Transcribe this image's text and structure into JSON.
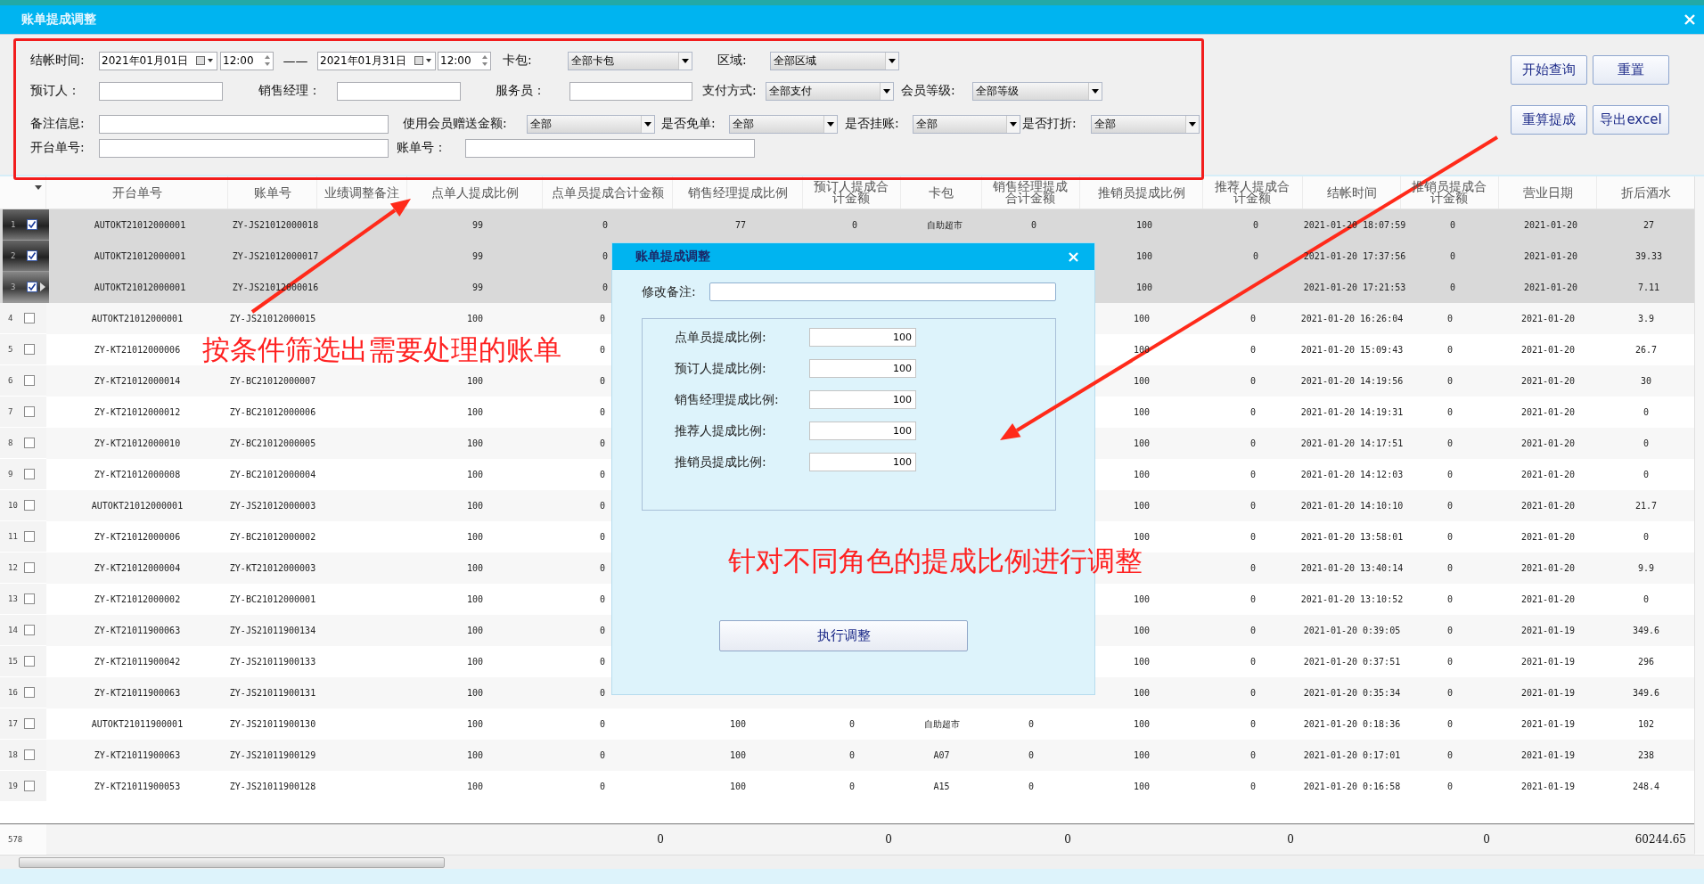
{
  "window": {
    "title": "账单提成调整"
  },
  "filters": {
    "checkout_time": {
      "label": "结帐时间:",
      "start_date": "2021年01月01日",
      "start_time": "12:00",
      "separator": "——",
      "end_date": "2021年01月31日",
      "end_time": "12:00"
    },
    "card_package": {
      "label": "卡包:",
      "value": "全部卡包"
    },
    "area": {
      "label": "区域:",
      "value": "全部区域"
    },
    "booker": {
      "label": "预订人："
    },
    "sales_manager": {
      "label": "销售经理："
    },
    "waiter": {
      "label": "服务员："
    },
    "payment_method": {
      "label": "支付方式:",
      "value": "全部支付"
    },
    "member_level": {
      "label": "会员等级:",
      "value": "全部等级"
    },
    "remark": {
      "label": "备注信息:"
    },
    "member_gift_amount": {
      "label": "使用会员赠送金额:",
      "value": "全部"
    },
    "free_bill": {
      "label": "是否免单:",
      "value": "全部"
    },
    "on_account": {
      "label": "是否挂账:",
      "value": "全部"
    },
    "discounted": {
      "label": "是否打折:",
      "value": "全部"
    },
    "open_order_no": {
      "label": "开台单号:"
    },
    "bill_no": {
      "label": "账单号："
    }
  },
  "buttons": [
    "开始查询",
    "重置",
    "重算提成",
    "导出excel"
  ],
  "table": {
    "columns": [
      {
        "label": "开台单号"
      },
      {
        "label": "账单号"
      },
      {
        "label": "业绩调整备注"
      },
      {
        "label": "点单人提成比例"
      },
      {
        "label": "点单员提成合计金额",
        "total": "0"
      },
      {
        "label": "销售经理提成比例"
      },
      {
        "label": "预订人提成合计金额",
        "total": "0"
      },
      {
        "label": "卡包"
      },
      {
        "label": "销售经理提成合计金额",
        "total": "0"
      },
      {
        "label": "推销员提成比例"
      },
      {
        "label": "推荐人提成合计金额",
        "total": "0"
      },
      {
        "label": "结帐时间"
      },
      {
        "label": "推销员提成合计金额",
        "total": "0"
      },
      {
        "label": "营业日期"
      },
      {
        "label": "折后酒水",
        "total": "60244.65"
      }
    ],
    "rows": [
      {
        "number": "1",
        "checked": true,
        "selected": true,
        "current": false,
        "cells": [
          "AUTOKT21012000001",
          "ZY-JS21012000018",
          null,
          "99",
          "0",
          "77",
          "0",
          "自助超市",
          "0",
          "100",
          "0",
          "2021-01-20 18:07:59",
          "0",
          "2021-01-20",
          "27"
        ]
      },
      {
        "number": "2",
        "checked": true,
        "selected": true,
        "current": false,
        "cells": [
          "AUTOKT21012000001",
          "ZY-JS21012000017",
          null,
          "99",
          "0",
          null,
          null,
          null,
          null,
          "100",
          "0",
          "2021-01-20 17:37:56",
          "0",
          "2021-01-20",
          "39.33"
        ]
      },
      {
        "number": "3",
        "checked": true,
        "selected": true,
        "current": true,
        "cells": [
          "AUTOKT21012000001",
          "ZY-JS21012000016",
          null,
          "99",
          "0",
          null,
          null,
          null,
          null,
          "100",
          null,
          "2021-01-20 17:21:53",
          "0",
          "2021-01-20",
          "7.11"
        ]
      },
      {
        "number": "4",
        "checked": false,
        "selected": false,
        "current": false,
        "cells": [
          "AUTOKT21012000001",
          "ZY-JS21012000015",
          null,
          "100",
          "0",
          null,
          null,
          null,
          null,
          "100",
          "0",
          "2021-01-20 16:26:04",
          "0",
          "2021-01-20",
          "3.9"
        ]
      },
      {
        "number": "5",
        "checked": false,
        "selected": false,
        "current": false,
        "cells": [
          "ZY-KT21012000006",
          null,
          null,
          null,
          "0",
          null,
          null,
          null,
          null,
          "100",
          "0",
          "2021-01-20 15:09:43",
          "0",
          "2021-01-20",
          "26.7"
        ]
      },
      {
        "number": "6",
        "checked": false,
        "selected": false,
        "current": false,
        "cells": [
          "ZY-KT21012000014",
          "ZY-BC21012000007",
          null,
          "100",
          "0",
          null,
          null,
          null,
          null,
          "100",
          "0",
          "2021-01-20 14:19:56",
          "0",
          "2021-01-20",
          "30"
        ]
      },
      {
        "number": "7",
        "checked": false,
        "selected": false,
        "current": false,
        "cells": [
          "ZY-KT21012000012",
          "ZY-BC21012000006",
          null,
          "100",
          "0",
          null,
          null,
          null,
          null,
          "100",
          "0",
          "2021-01-20 14:19:31",
          "0",
          "2021-01-20",
          "0"
        ]
      },
      {
        "number": "8",
        "checked": false,
        "selected": false,
        "current": false,
        "cells": [
          "ZY-KT21012000010",
          "ZY-BC21012000005",
          null,
          "100",
          "0",
          null,
          null,
          null,
          null,
          "100",
          "0",
          "2021-01-20 14:17:51",
          "0",
          "2021-01-20",
          "0"
        ]
      },
      {
        "number": "9",
        "checked": false,
        "selected": false,
        "current": false,
        "cells": [
          "ZY-KT21012000008",
          "ZY-BC21012000004",
          null,
          "100",
          "0",
          null,
          null,
          null,
          null,
          "100",
          "0",
          "2021-01-20 14:12:03",
          "0",
          "2021-01-20",
          "0"
        ]
      },
      {
        "number": "10",
        "checked": false,
        "selected": false,
        "current": false,
        "cells": [
          "AUTOKT21012000001",
          "ZY-JS21012000003",
          null,
          "100",
          "0",
          null,
          null,
          null,
          null,
          "100",
          "0",
          "2021-01-20 14:10:10",
          "0",
          "2021-01-20",
          "21.7"
        ]
      },
      {
        "number": "11",
        "checked": false,
        "selected": false,
        "current": false,
        "cells": [
          "ZY-KT21012000006",
          "ZY-BC21012000002",
          null,
          "100",
          "0",
          null,
          null,
          null,
          null,
          "100",
          "0",
          "2021-01-20 13:58:01",
          "0",
          "2021-01-20",
          "0"
        ]
      },
      {
        "number": "12",
        "checked": false,
        "selected": false,
        "current": false,
        "cells": [
          "ZY-KT21012000004",
          "ZY-KT21012000003",
          null,
          "100",
          "0",
          null,
          null,
          null,
          null,
          null,
          "0",
          "2021-01-20 13:40:14",
          "0",
          "2021-01-20",
          "9.9"
        ]
      },
      {
        "number": "13",
        "checked": false,
        "selected": false,
        "current": false,
        "cells": [
          "ZY-KT21012000002",
          "ZY-BC21012000001",
          null,
          "100",
          "0",
          null,
          null,
          null,
          null,
          "100",
          "0",
          "2021-01-20 13:10:52",
          "0",
          "2021-01-20",
          "0"
        ]
      },
      {
        "number": "14",
        "checked": false,
        "selected": false,
        "current": false,
        "cells": [
          "ZY-KT21011900063",
          "ZY-JS21011900134",
          null,
          "100",
          "0",
          null,
          null,
          null,
          null,
          "100",
          "0",
          "2021-01-20 0:39:05",
          "0",
          "2021-01-19",
          "349.6"
        ]
      },
      {
        "number": "15",
        "checked": false,
        "selected": false,
        "current": false,
        "cells": [
          "ZY-KT21011900042",
          "ZY-JS21011900133",
          null,
          "100",
          "0",
          null,
          null,
          null,
          null,
          "100",
          "0",
          "2021-01-20 0:37:51",
          "0",
          "2021-01-19",
          "296"
        ]
      },
      {
        "number": "16",
        "checked": false,
        "selected": false,
        "current": false,
        "cells": [
          "ZY-KT21011900063",
          "ZY-JS21011900131",
          null,
          "100",
          "0",
          null,
          null,
          null,
          null,
          "100",
          "0",
          "2021-01-20 0:35:34",
          "0",
          "2021-01-19",
          "349.6"
        ]
      },
      {
        "number": "17",
        "checked": false,
        "selected": false,
        "current": false,
        "cells": [
          "AUTOKT21011900001",
          "ZY-JS21011900130",
          null,
          "100",
          "0",
          "100",
          "0",
          "自助超市",
          "0",
          "100",
          "0",
          "2021-01-20 0:18:36",
          "0",
          "2021-01-19",
          "102"
        ]
      },
      {
        "number": "18",
        "checked": false,
        "selected": false,
        "current": false,
        "cells": [
          "ZY-KT21011900063",
          "ZY-JS21011900129",
          null,
          "100",
          "0",
          "100",
          "0",
          "A07",
          "0",
          "100",
          "0",
          "2021-01-20 0:17:01",
          "0",
          "2021-01-19",
          "238"
        ]
      },
      {
        "number": "19",
        "checked": false,
        "selected": false,
        "current": false,
        "cells": [
          "ZY-KT21011900053",
          "ZY-JS21011900128",
          null,
          "100",
          "0",
          "100",
          "0",
          "A15",
          "0",
          "100",
          "0",
          "2021-01-20 0:16:58",
          "0",
          "2021-01-19",
          "248.4"
        ]
      }
    ],
    "footer": {
      "count": "578"
    }
  },
  "dialog": {
    "title": "账单提成调整",
    "remark_label": "修改备注:",
    "ratios": [
      {
        "label": "点单员提成比例:",
        "value": "100"
      },
      {
        "label": "预订人提成比例:",
        "value": "100"
      },
      {
        "label": "销售经理提成比例:",
        "value": "100"
      },
      {
        "label": "推荐人提成比例:",
        "value": "100"
      },
      {
        "label": "推销员提成比例:",
        "value": "100"
      }
    ],
    "button": "执行调整"
  },
  "annotations": [
    "按条件筛选出需要处理的账单",
    "针对不同角色的提成比例进行调整"
  ]
}
